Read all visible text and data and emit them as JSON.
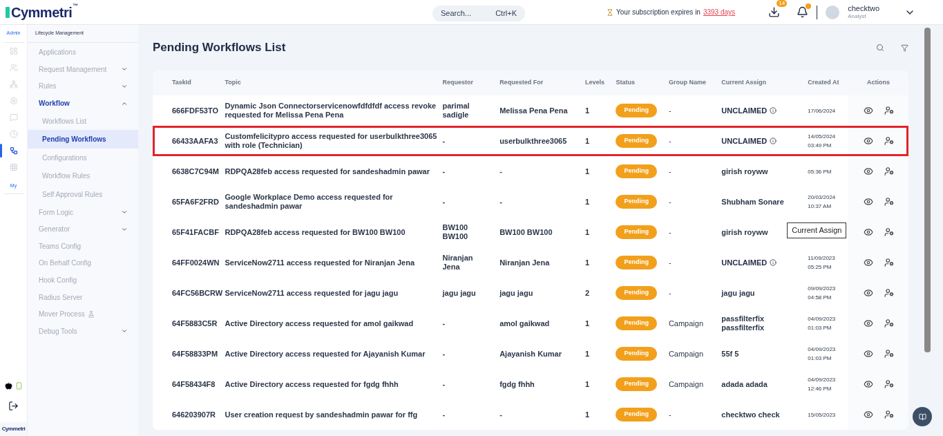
{
  "header": {
    "logo": "Cymmetri",
    "logo_mark": "™",
    "search": {
      "placeholder": "Search...",
      "shortcut": "Ctrl+K"
    },
    "subscription": {
      "text": "Your subscription expires in",
      "link": "3393 days"
    },
    "download_badge": "14",
    "user": {
      "name": "checktwo",
      "role": "Analyst"
    }
  },
  "rail": {
    "sections": [
      {
        "label": "Admin",
        "kind": "label"
      }
    ],
    "items": [
      {
        "selected": false
      },
      {
        "selected": false
      },
      {
        "selected": false
      },
      {
        "selected": false
      },
      {
        "selected": false
      },
      {
        "selected": false
      },
      {
        "selected": true
      },
      {
        "selected": false
      }
    ],
    "my_label": "My",
    "footer_logo": "Cymmetri"
  },
  "sidebar": {
    "title": "Lifecycle Management",
    "items": [
      {
        "label": "Applications",
        "expandable": false,
        "selected": false
      },
      {
        "label": "Request Management",
        "expandable": true,
        "expanded": false,
        "selected": false
      },
      {
        "label": "Rules",
        "expandable": true,
        "expanded": false,
        "selected": false
      },
      {
        "label": "Workflow",
        "expandable": true,
        "expanded": true,
        "selected": true,
        "children": [
          {
            "label": "Workflows List",
            "selected": false
          },
          {
            "label": "Pending Workflows",
            "selected": true
          },
          {
            "label": "Configurations",
            "selected": false
          },
          {
            "label": "Workflow Rules",
            "selected": false
          },
          {
            "label": "Self Approval Rules",
            "selected": false
          }
        ]
      },
      {
        "label": "Form Logic",
        "expandable": true,
        "expanded": false,
        "selected": false
      },
      {
        "label": "Generator",
        "expandable": true,
        "expanded": false,
        "selected": false
      },
      {
        "label": "Teams Config",
        "expandable": false,
        "selected": false
      },
      {
        "label": "On Behalf Config",
        "expandable": false,
        "selected": false
      },
      {
        "label": "Hook Config",
        "expandable": false,
        "selected": false
      },
      {
        "label": "Radius Server",
        "expandable": false,
        "selected": false
      },
      {
        "label": "Mover Process",
        "expandable": false,
        "selected": false,
        "beta": true
      },
      {
        "label": "Debug Tools",
        "expandable": true,
        "expanded": false,
        "selected": false
      }
    ]
  },
  "page": {
    "title": "Pending Workflows List"
  },
  "table": {
    "columns": [
      "TaskId",
      "Topic",
      "Requestor",
      "Requested For",
      "Levels",
      "Status",
      "Group Name",
      "Current Assign",
      "Created At",
      "Actions"
    ],
    "rows": [
      {
        "task_id": "666FDF53TO",
        "topic": "Dynamic Json Connectorservicenowfdfdfdf access revoke requested for Melissa Pena Pena",
        "requestor": "parimal sadigle",
        "requested_for": "Melissa Pena Pena",
        "levels": "1",
        "status": "Pending",
        "group": "-",
        "assign": "UNCLAIMED",
        "unclaimed": true,
        "created": [
          "17/06/2024"
        ],
        "highlighted": false
      },
      {
        "task_id": "66433AAFA3",
        "topic": "Customfelicitypro access requested for userbulkthree3065 with role (Technician)",
        "requestor": "-",
        "requested_for": "userbulkthree3065",
        "levels": "1",
        "status": "Pending",
        "group": "-",
        "assign": "UNCLAIMED",
        "unclaimed": true,
        "created": [
          "14/05/2024",
          "03:49 PM"
        ],
        "highlighted": true
      },
      {
        "task_id": "6638C7C94M",
        "topic": "RDPQA28feb access requested for sandeshadmin pawar",
        "requestor": "-",
        "requested_for": "-",
        "levels": "1",
        "status": "Pending",
        "group": "-",
        "assign": "girish royww",
        "unclaimed": false,
        "created": [
          "05:36 PM"
        ],
        "highlighted": false
      },
      {
        "task_id": "65FA6F2FRD",
        "topic": "Google Workplace Demo access requested for sandeshadmin pawar",
        "requestor": "-",
        "requested_for": "-",
        "levels": "1",
        "status": "Pending",
        "group": "-",
        "assign": "Shubham Sonare",
        "unclaimed": false,
        "created": [
          "20/03/2024",
          "10:37 AM"
        ],
        "highlighted": false
      },
      {
        "task_id": "65F41FACBF",
        "topic": "RDPQA28feb access requested for BW100 BW100",
        "requestor": "BW100 BW100",
        "requested_for": "BW100 BW100",
        "levels": "1",
        "status": "Pending",
        "group": "-",
        "assign": "girish royww",
        "unclaimed": false,
        "created": [],
        "tooltip": "Current Assign",
        "highlighted": false
      },
      {
        "task_id": "64FF0024WN",
        "topic": "ServiceNow2711 access requested for Niranjan Jena",
        "requestor": "Niranjan Jena",
        "requested_for": "Niranjan Jena",
        "levels": "1",
        "status": "Pending",
        "group": "-",
        "assign": "UNCLAIMED",
        "unclaimed": true,
        "created": [
          "11/09/2023",
          "05:25 PM"
        ],
        "highlighted": false
      },
      {
        "task_id": "64FC56BCRW",
        "topic": "ServiceNow2711 access requested for jagu jagu",
        "requestor": "jagu jagu",
        "requested_for": "jagu jagu",
        "levels": "2",
        "status": "Pending",
        "group": "-",
        "assign": "jagu jagu",
        "unclaimed": false,
        "created": [
          "09/09/2023",
          "04:58 PM"
        ],
        "highlighted": false
      },
      {
        "task_id": "64F5883C5R",
        "topic": "Active Directory access requested for amol gaikwad",
        "requestor": "-",
        "requested_for": "amol gaikwad",
        "levels": "1",
        "status": "Pending",
        "group": "Campaign",
        "assign": "passfilterfix passfilterfix",
        "unclaimed": false,
        "created": [
          "04/09/2023",
          "01:03 PM"
        ],
        "highlighted": false
      },
      {
        "task_id": "64F58833PM",
        "topic": "Active Directory access requested for Ajayanish Kumar",
        "requestor": "-",
        "requested_for": "Ajayanish Kumar",
        "levels": "1",
        "status": "Pending",
        "group": "Campaign",
        "assign": "55f 5",
        "unclaimed": false,
        "created": [
          "04/09/2023",
          "01:03 PM"
        ],
        "highlighted": false
      },
      {
        "task_id": "64F58434F8",
        "topic": "Active Directory access requested for fgdg fhhh",
        "requestor": "-",
        "requested_for": "fgdg fhhh",
        "levels": "1",
        "status": "Pending",
        "group": "Campaign",
        "assign": "adada adada",
        "unclaimed": false,
        "created": [
          "04/09/2023",
          "12:46 PM"
        ],
        "highlighted": false
      },
      {
        "task_id": "646203907R",
        "topic": "User creation request by sandeshadmin pawar for ffg",
        "requestor": "-",
        "requested_for": "-",
        "levels": "1",
        "status": "Pending",
        "group": "-",
        "assign": "checktwo check",
        "unclaimed": false,
        "created": [
          "15/05/2023"
        ],
        "highlighted": false
      }
    ]
  }
}
